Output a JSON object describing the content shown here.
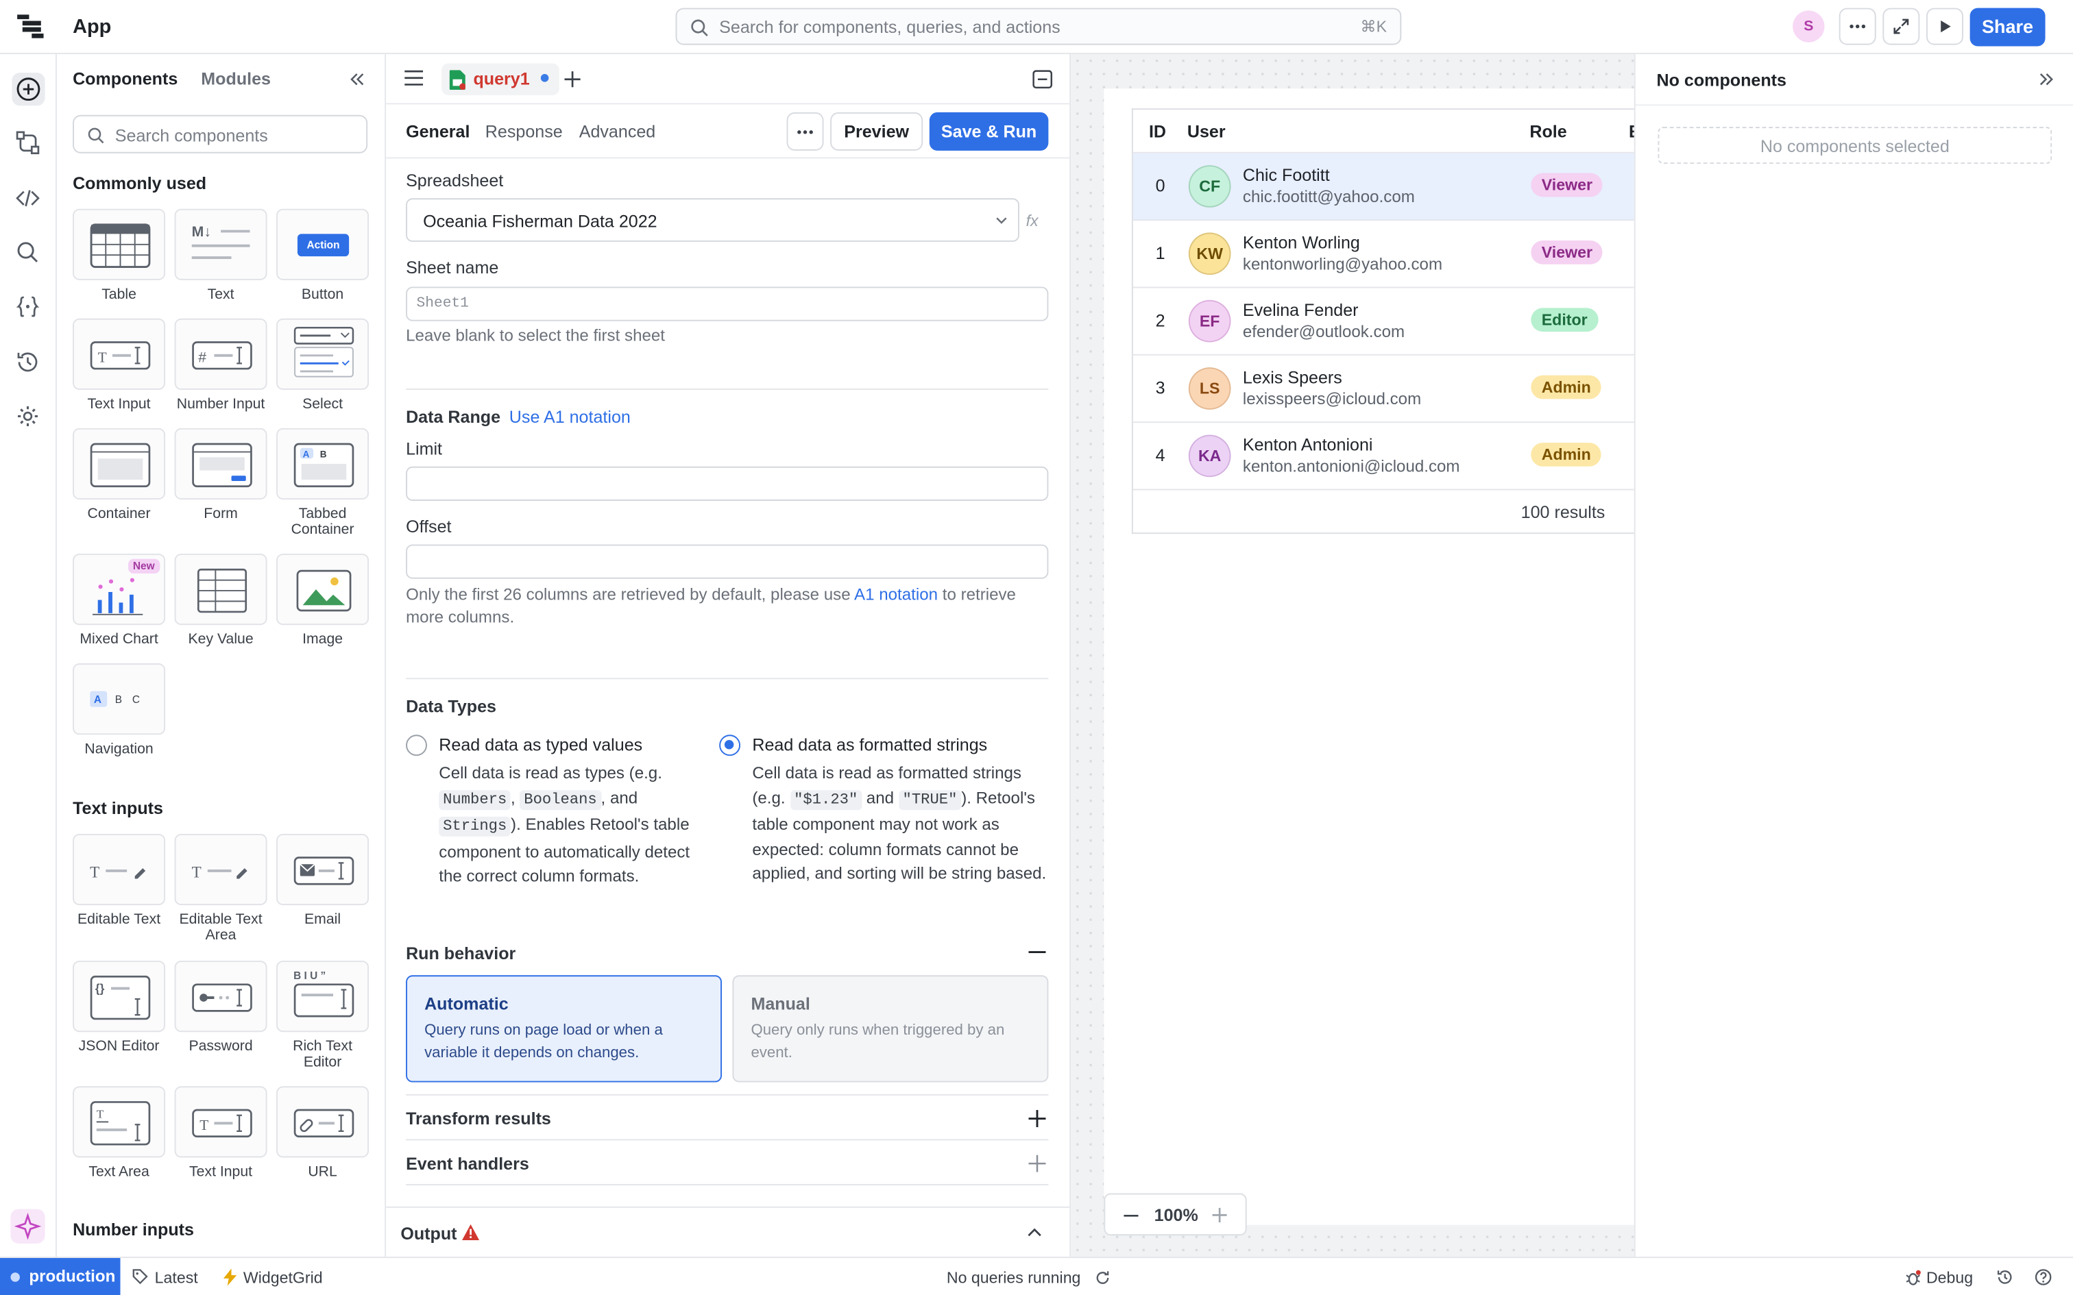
{
  "app": {
    "title": "App",
    "search_placeholder": "Search for components, queries, and actions",
    "search_shortcut": "⌘K",
    "user_initial": "S",
    "share_label": "Share"
  },
  "components_panel": {
    "tab_components": "Components",
    "tab_modules": "Modules",
    "search_placeholder": "Search components",
    "sections": [
      {
        "title": "Commonly used"
      },
      {
        "title": "Text inputs"
      },
      {
        "title": "Number inputs"
      }
    ],
    "tiles": [
      {
        "label": "Table"
      },
      {
        "label": "Text"
      },
      {
        "label": "Button"
      },
      {
        "label": "Text Input"
      },
      {
        "label": "Number Input"
      },
      {
        "label": "Select"
      },
      {
        "label": "Container"
      },
      {
        "label": "Form"
      },
      {
        "label": "Tabbed Container"
      },
      {
        "label": "Mixed Chart",
        "badge": "New"
      },
      {
        "label": "Key Value"
      },
      {
        "label": "Image"
      },
      {
        "label": "Navigation"
      },
      {
        "label": "Editable Text"
      },
      {
        "label": "Editable Text Area"
      },
      {
        "label": "Email"
      },
      {
        "label": "JSON Editor"
      },
      {
        "label": "Password"
      },
      {
        "label": "Rich Text Editor"
      },
      {
        "label": "Text Area"
      },
      {
        "label": "Text Input"
      },
      {
        "label": "URL"
      }
    ],
    "button_tile_text": "Action",
    "text_tile_text": "M↓"
  },
  "query": {
    "tab_name": "query1",
    "subtabs": {
      "general": "General",
      "response": "Response",
      "advanced": "Advanced"
    },
    "preview_label": "Preview",
    "save_run_label": "Save & Run",
    "spreadsheet_label": "Spreadsheet",
    "spreadsheet_value": "Oceania Fisherman Data 2022",
    "fx_label": "fx",
    "sheet_name_label": "Sheet name",
    "sheet_name_placeholder": "Sheet1",
    "sheet_name_hint": "Leave blank to select the first sheet",
    "data_range_label": "Data Range",
    "data_range_link": "Use A1 notation",
    "limit_label": "Limit",
    "offset_label": "Offset",
    "columns_hint_pre": "Only the first 26 columns are retrieved by default, please use",
    "columns_hint_link": "A1 notation",
    "columns_hint_post": "to retrieve more columns.",
    "data_types_label": "Data Types",
    "typed": {
      "title": "Read data as typed values",
      "desc_1": "Cell data is read as types (e.g.",
      "code_1": "Numbers",
      "sep_1": ",",
      "code_2": "Booleans",
      "sep_2": ", and",
      "code_3": "Strings",
      "desc_2": "). Enables Retool's table component to automatically detect the correct column formats."
    },
    "formatted": {
      "title": "Read data as formatted strings",
      "desc_1": "Cell data is read as formatted strings (e.g.",
      "code_1": "\"$1.23\"",
      "sep_1": "and",
      "code_2": "\"TRUE\"",
      "desc_2": "). Retool's table component may not work as expected: column formats cannot be applied, and sorting will be string based."
    },
    "run_behavior_label": "Run behavior",
    "automatic": {
      "title": "Automatic",
      "desc": "Query runs on page load or when a variable it depends on changes."
    },
    "manual": {
      "title": "Manual",
      "desc": "Query only runs when triggered by an event."
    },
    "transform_label": "Transform results",
    "event_handlers_label": "Event handlers",
    "output_label": "Output"
  },
  "table": {
    "columns": [
      "ID",
      "User",
      "Role",
      "E"
    ],
    "rows": [
      {
        "id": "0",
        "initials": "CF",
        "name": "Chic Footitt",
        "email": "chic.footitt@yahoo.com",
        "role": "Viewer",
        "avatar_bg": "#c6f1dc",
        "avatar_fg": "#1d6b3d"
      },
      {
        "id": "1",
        "initials": "KW",
        "name": "Kenton Worling",
        "email": "kentonworling@yahoo.com",
        "role": "Viewer",
        "avatar_bg": "#fbe49a",
        "avatar_fg": "#6e4c00"
      },
      {
        "id": "2",
        "initials": "EF",
        "name": "Evelina Fender",
        "email": "efender@outlook.com",
        "role": "Editor",
        "avatar_bg": "#f3d3f4",
        "avatar_fg": "#8b2a86"
      },
      {
        "id": "3",
        "initials": "LS",
        "name": "Lexis Speers",
        "email": "lexisspeers@icloud.com",
        "role": "Admin",
        "avatar_bg": "#fbd6b4",
        "avatar_fg": "#8a4a12"
      },
      {
        "id": "4",
        "initials": "KA",
        "name": "Kenton Antonioni",
        "email": "kenton.antonioni@icloud.com",
        "role": "Admin",
        "avatar_bg": "#ecd3f5",
        "avatar_fg": "#7a2a8b"
      }
    ],
    "footer": "100 results",
    "zoom": "100%"
  },
  "inspector": {
    "title": "No components",
    "empty_text": "No components selected"
  },
  "status": {
    "environment": "production",
    "version": "Latest",
    "widget": "WidgetGrid",
    "queries": "No queries running",
    "debug": "Debug"
  },
  "colors": {
    "accent": "#2f6fe6",
    "selected_row": "#e8effd"
  }
}
